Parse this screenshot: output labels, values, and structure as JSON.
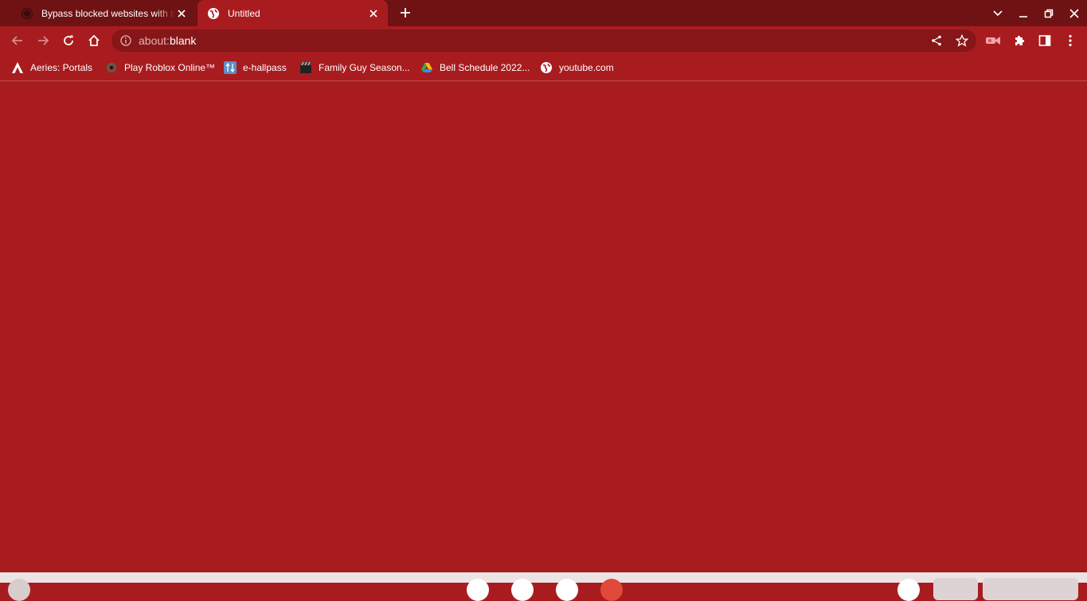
{
  "tabs": [
    {
      "title": "Bypass blocked websites with th",
      "favicon": "github-icon",
      "active": false
    },
    {
      "title": "Untitled",
      "favicon": "globe-icon",
      "active": true
    }
  ],
  "omnibox": {
    "url_scheme": "about:",
    "url_host": "blank"
  },
  "bookmarks": [
    {
      "label": "Aeries: Portals",
      "icon": "aeries-icon"
    },
    {
      "label": "Play Roblox Online™",
      "icon": "roblox-icon"
    },
    {
      "label": "e-hallpass",
      "icon": "ehallpass-icon"
    },
    {
      "label": "Family Guy Season...",
      "icon": "clapperboard-icon"
    },
    {
      "label": "Bell Schedule 2022...",
      "icon": "google-drive-icon"
    },
    {
      "label": "youtube.com",
      "icon": "globe-icon"
    }
  ],
  "colors": {
    "theme": "#a81c1f",
    "tabstrip": "#6e1214",
    "omnibox": "#861618"
  }
}
